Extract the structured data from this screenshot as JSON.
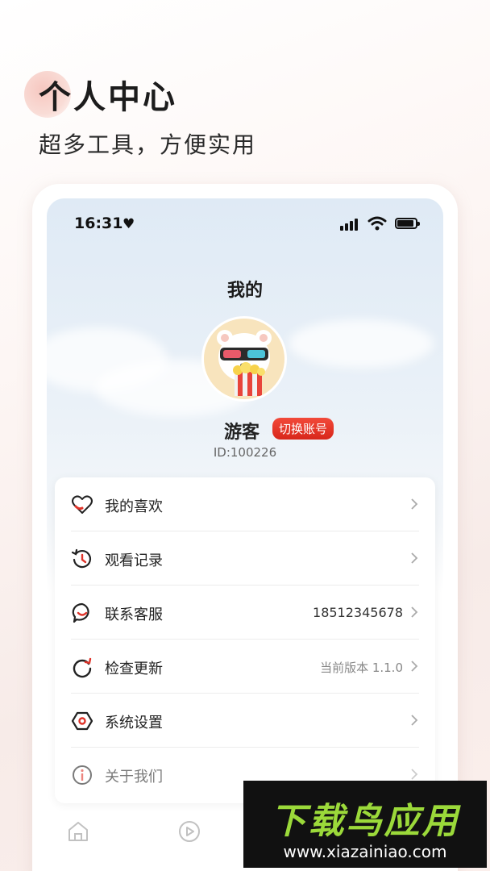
{
  "hero": {
    "title": "个人中心",
    "subtitle": "超多工具，方便实用"
  },
  "status_bar": {
    "time": "16:31",
    "heart": "♥",
    "icons": [
      "signal-icon",
      "wifi-icon",
      "battery-icon"
    ]
  },
  "page": {
    "title": "我的"
  },
  "profile": {
    "username": "游客",
    "switch_label": "切换账号",
    "user_id": "ID:100226"
  },
  "menu": {
    "items": [
      {
        "label": "我的喜欢",
        "value": "",
        "icon": "heart-icon"
      },
      {
        "label": "观看记录",
        "value": "",
        "icon": "history-icon"
      },
      {
        "label": "联系客服",
        "value": "18512345678",
        "icon": "customer-service-icon"
      },
      {
        "label": "检查更新",
        "value": "当前版本 1.1.0",
        "icon": "refresh-icon"
      },
      {
        "label": "系统设置",
        "value": "",
        "icon": "settings-icon"
      },
      {
        "label": "关于我们",
        "value": "",
        "icon": "info-icon"
      }
    ]
  },
  "tabbar": {
    "items": [
      {
        "icon": "home-icon"
      },
      {
        "icon": "play-icon"
      }
    ]
  },
  "watermark": {
    "logo": "下载鸟应用",
    "url": "www.xiazainiao.com"
  },
  "colors": {
    "accent": "#d8261a",
    "icon_red": "#e0342a",
    "watermark_green": "#9bd93a"
  }
}
